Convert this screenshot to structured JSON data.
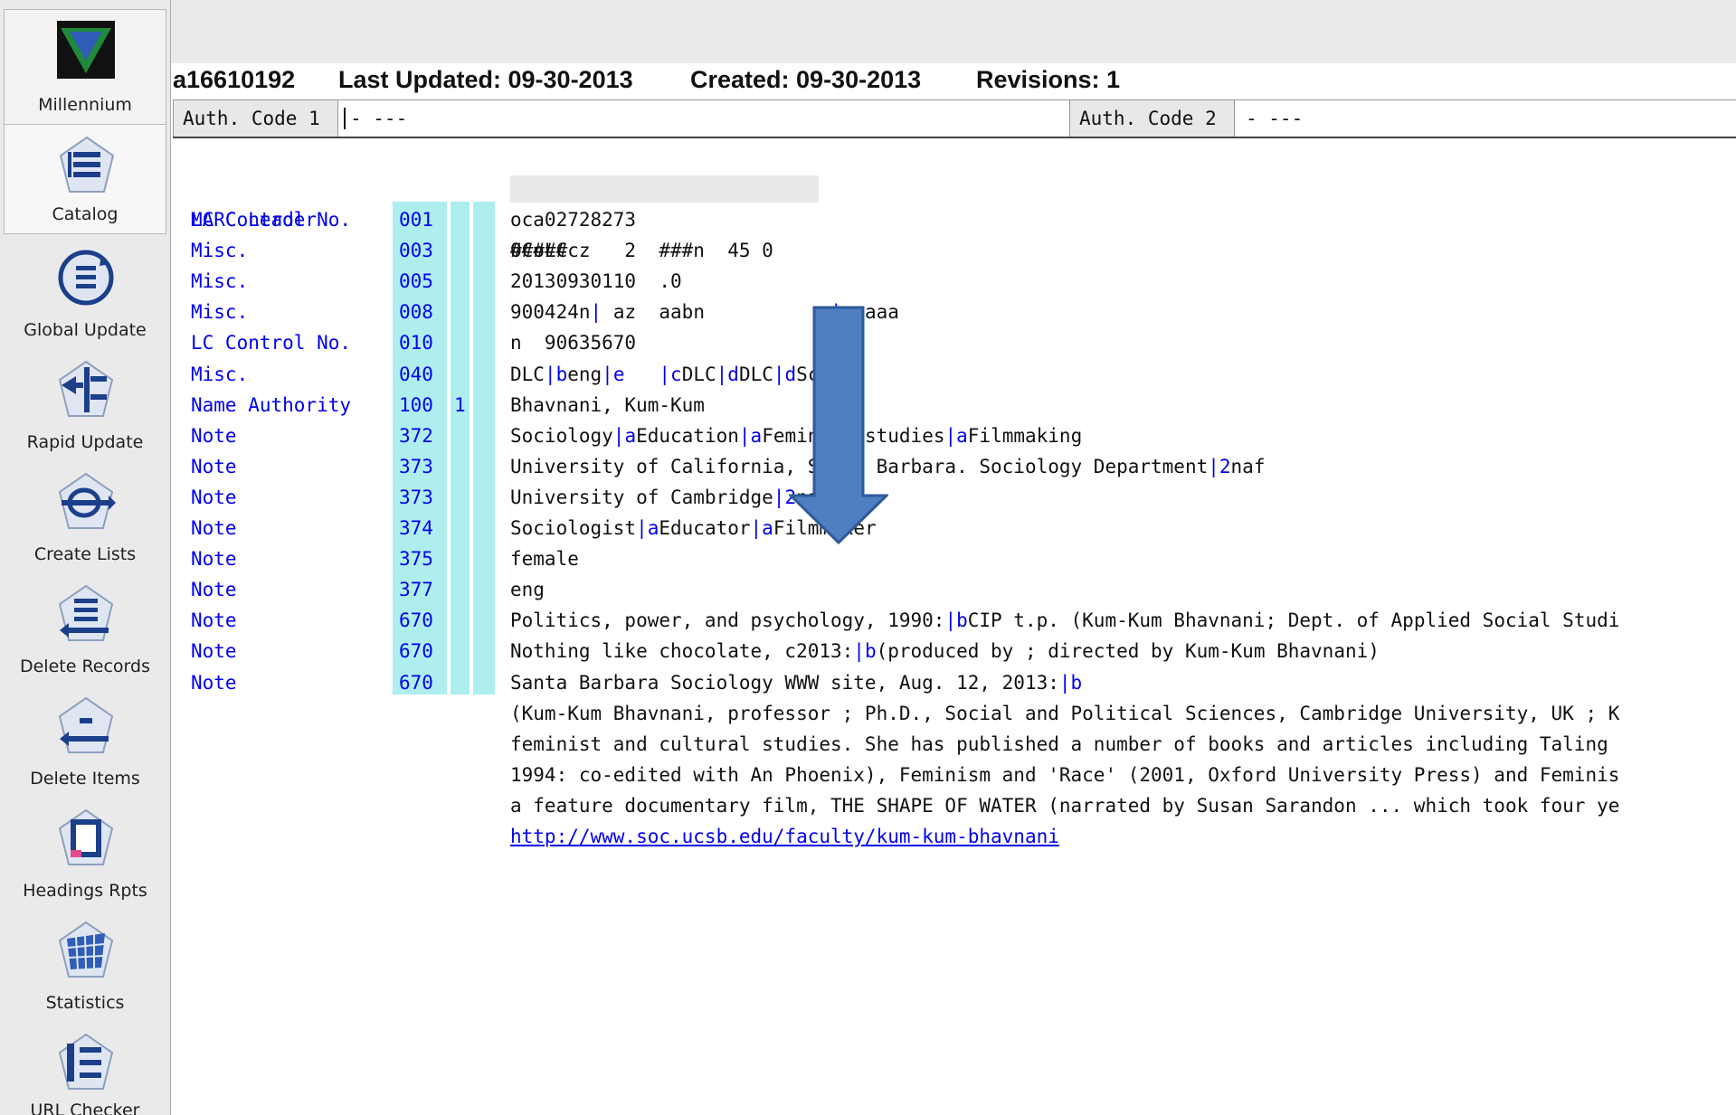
{
  "sidebar": {
    "items": [
      {
        "label": "Millennium",
        "icon": "millennium-logo-icon"
      },
      {
        "label": "Catalog",
        "icon": "catalog-icon"
      },
      {
        "label": "Global Update",
        "icon": "global-update-icon"
      },
      {
        "label": "Rapid Update",
        "icon": "rapid-update-icon"
      },
      {
        "label": "Create Lists",
        "icon": "create-lists-icon"
      },
      {
        "label": "Delete Records",
        "icon": "delete-records-icon"
      },
      {
        "label": "Delete Items",
        "icon": "delete-items-icon"
      },
      {
        "label": "Headings Rpts",
        "icon": "headings-rpts-icon"
      },
      {
        "label": "Statistics",
        "icon": "statistics-icon"
      },
      {
        "label": "URL Checker",
        "icon": "url-checker-icon"
      }
    ]
  },
  "header": {
    "record_id": "a16610192",
    "last_updated": "Last Updated: 09-30-2013",
    "created": "Created: 09-30-2013",
    "revisions": "Revisions: 1"
  },
  "auth_codes": {
    "code1_label": "Auth. Code 1",
    "code1_value": "-  ---",
    "code2_label": "Auth. Code 2",
    "code2_value": "-  ---"
  },
  "marc": {
    "leader_label": "MARC Leader",
    "leader_value": "#####cz   2  ###n  45 0",
    "fields": [
      {
        "label": "LC Control No.",
        "tag": "001",
        "ind1": "",
        "ind2": "",
        "data": "oca02728273"
      },
      {
        "label": "Misc.",
        "tag": "003",
        "ind1": "",
        "ind2": "",
        "data": "OCoLC"
      },
      {
        "label": "Misc.",
        "tag": "005",
        "ind1": "",
        "ind2": "",
        "data": "20130930110  .0"
      },
      {
        "label": "Misc.",
        "tag": "008",
        "ind1": "",
        "ind2": "",
        "data": "900424n| az  aabn           |n aaa"
      },
      {
        "label": "LC Control No.",
        "tag": "010",
        "ind1": "",
        "ind2": "",
        "data": "n  90635670"
      },
      {
        "label": "Misc.",
        "tag": "040",
        "ind1": "",
        "ind2": "",
        "data": "DLC|beng|e   |cDLC|dDLC|dScU"
      },
      {
        "label": "Name Authority",
        "tag": "100",
        "ind1": "1",
        "ind2": "",
        "data": "Bhavnani, Kum-Kum"
      },
      {
        "label": "Note",
        "tag": "372",
        "ind1": "",
        "ind2": "",
        "data": "Sociology|aEducation|aFeminist studies|aFilmmaking"
      },
      {
        "label": "Note",
        "tag": "373",
        "ind1": "",
        "ind2": "",
        "data": "University of California, Santa Barbara. Sociology Department|2naf"
      },
      {
        "label": "Note",
        "tag": "373",
        "ind1": "",
        "ind2": "",
        "data": "University of Cambridge|2naf"
      },
      {
        "label": "Note",
        "tag": "374",
        "ind1": "",
        "ind2": "",
        "data": "Sociologist|aEducator|aFilmmaker"
      },
      {
        "label": "Note",
        "tag": "375",
        "ind1": "",
        "ind2": "",
        "data": "female"
      },
      {
        "label": "Note",
        "tag": "377",
        "ind1": "",
        "ind2": "",
        "data": "eng"
      },
      {
        "label": "Note",
        "tag": "670",
        "ind1": "",
        "ind2": "",
        "data": "Politics, power, and psychology, 1990:|bCIP t.p. (Kum-Kum Bhavnani; Dept. of Applied Social Studi"
      },
      {
        "label": "Note",
        "tag": "670",
        "ind1": "",
        "ind2": "",
        "data": "Nothing like chocolate, c2013:|b(produced by ; directed by Kum-Kum Bhavnani)"
      },
      {
        "label": "Note",
        "tag": "670",
        "ind1": "",
        "ind2": "",
        "data": "Santa Barbara Sociology WWW site, Aug. 12, 2013:|b"
      }
    ],
    "continuation_lines": [
      "(Kum-Kum Bhavnani, professor ; Ph.D., Social and Political Sciences, Cambridge University, UK ; K",
      "feminist and cultural studies. She has published a number of books and articles including Taling",
      "1994: co-edited with An Phoenix), Feminism and 'Race' (2001, Oxford University Press) and Feminis",
      "a feature documentary film, THE SHAPE OF WATER (narrated by Susan Sarandon ... which took four ye"
    ],
    "url": "http://www.soc.ucsb.edu/faculty/kum-kum-bhavnani"
  },
  "colors": {
    "label_blue": "#0000ee",
    "tag_column": "#aeeeee",
    "arrow_fill": "#4f7fc0"
  }
}
